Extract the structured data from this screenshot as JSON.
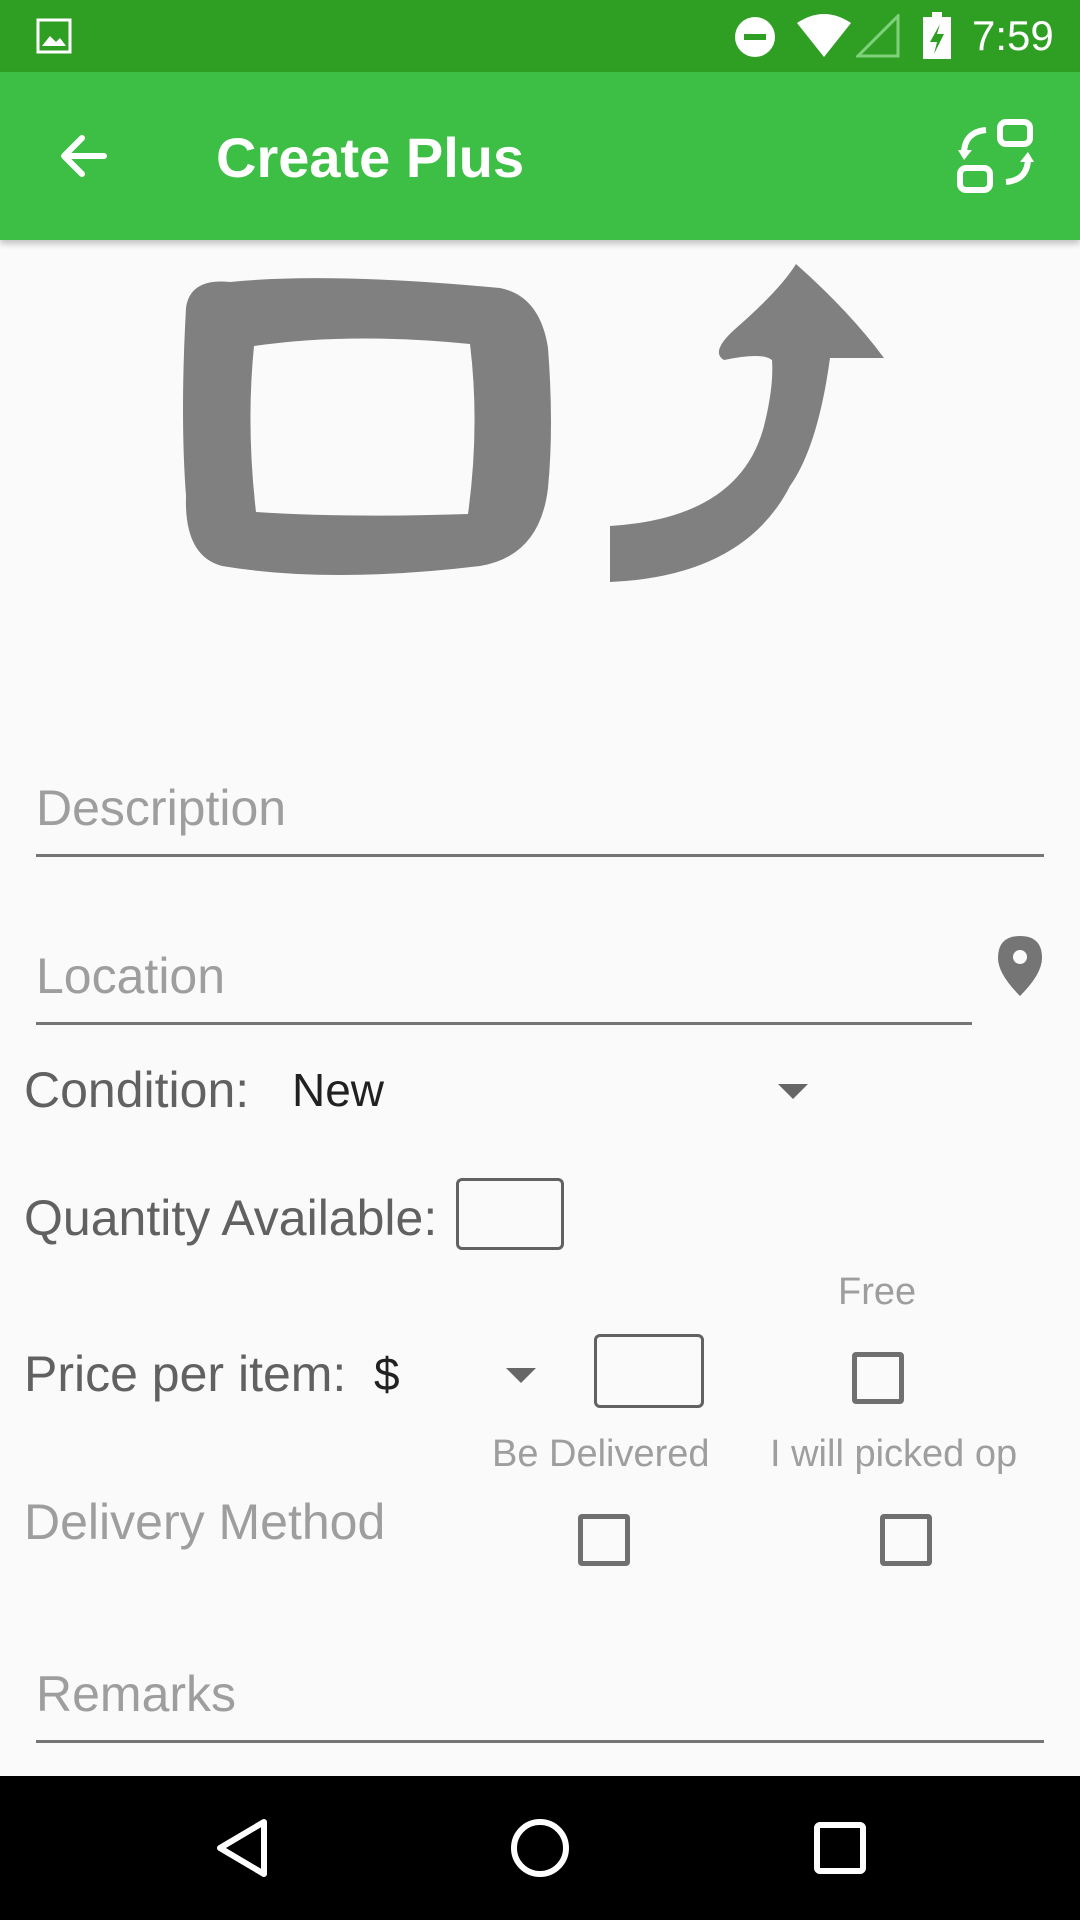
{
  "status_bar": {
    "time": "7:59",
    "icons": [
      "gallery-icon",
      "do-not-disturb-icon",
      "wifi-icon",
      "signal-icon",
      "battery-charging-icon"
    ]
  },
  "app_bar": {
    "title": "Create Plus",
    "back_icon": "arrow-back-icon",
    "action_icon": "swap-layout-icon",
    "color": "#3cbf44",
    "status_color": "#2e9f23"
  },
  "hero_image": {
    "icon": "rotate-frame-icon"
  },
  "form": {
    "description_placeholder": "Description",
    "location_placeholder": "Location",
    "location_icon": "location-pin-icon",
    "condition_label": "Condition:",
    "condition_value": "New",
    "quantity_label": "Quantity Available:",
    "quantity_value": "",
    "price_label": "Price per item:",
    "currency_value": "$",
    "price_value": "",
    "free_label": "Free",
    "delivery_label": "Delivery Method",
    "be_delivered_label": "Be Delivered",
    "pickup_label": "I will picked op",
    "remarks_placeholder": "Remarks"
  },
  "nav_bar": {
    "icons": [
      "back-triangle-icon",
      "home-circle-icon",
      "recents-square-icon"
    ]
  }
}
